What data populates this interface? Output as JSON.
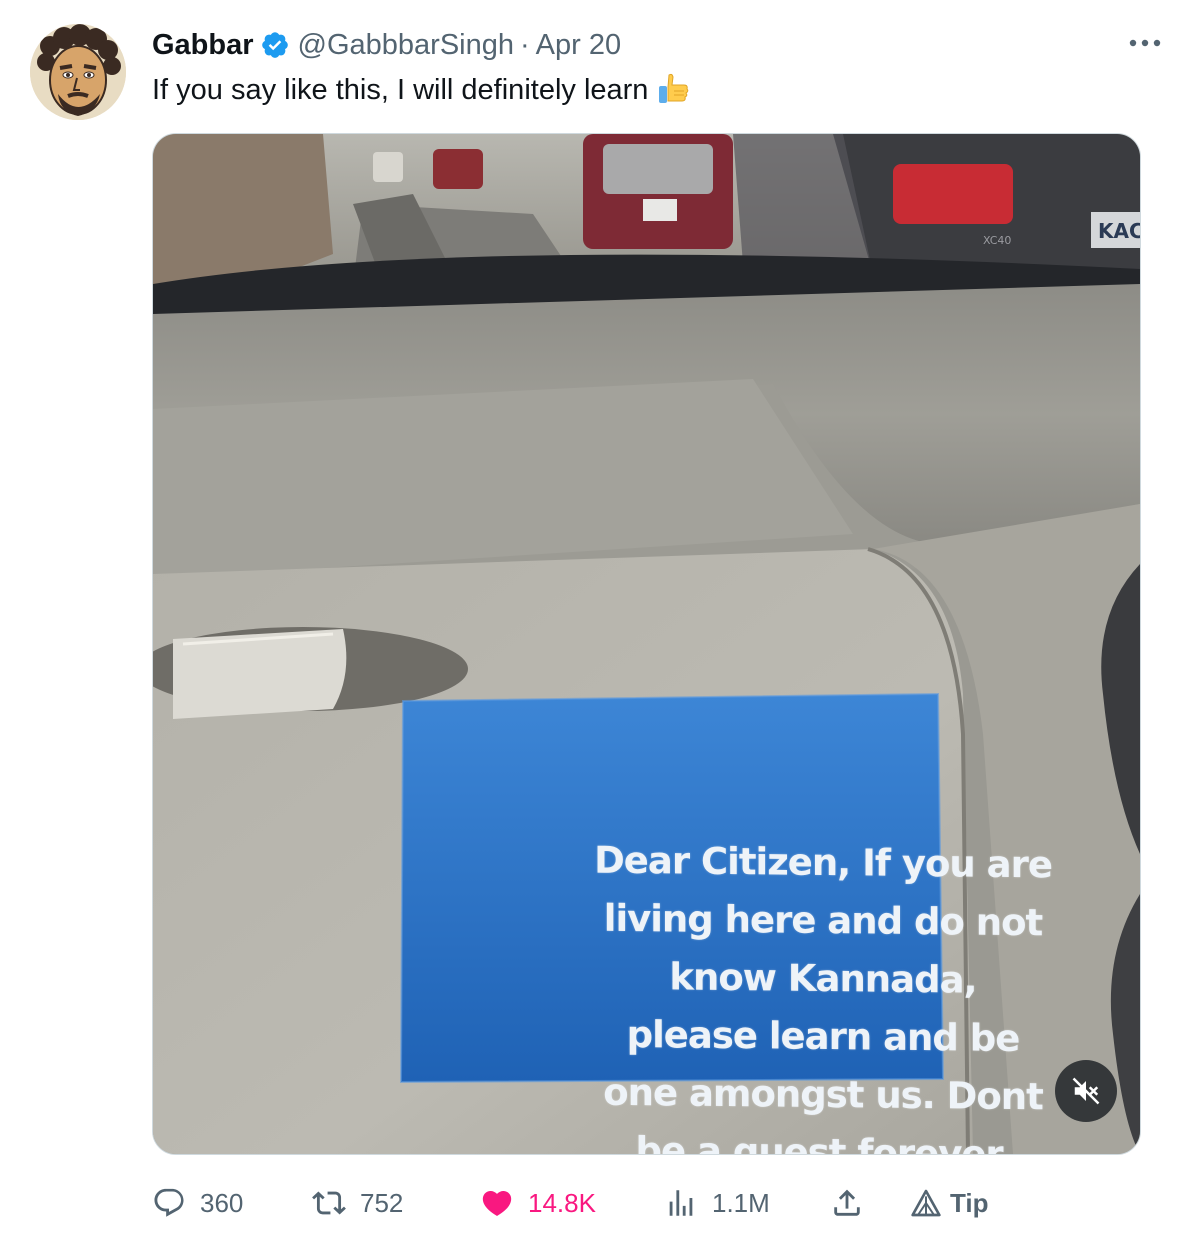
{
  "tweet": {
    "author_name": "Gabbar",
    "handle": "@GabbbarSingh",
    "separator": "·",
    "date": "Apr 20",
    "text": "If you say like this, I will definitely learn",
    "emoji_icon": "thumbs-up-icon",
    "verified_icon": "verified-badge-icon",
    "more_icon": "more-options-icon"
  },
  "media": {
    "sticker_lines": [
      "Dear Citizen, If you are",
      "living here and do not",
      "know Kannada,",
      "please learn and be",
      "one amongst us. Dont",
      "be a guest forever."
    ],
    "license_plate_text": "KAC",
    "car_badge_text": "XC40",
    "mute_icon": "speaker-muted-icon"
  },
  "actions": {
    "reply": {
      "icon": "reply-icon",
      "count": "360"
    },
    "retweet": {
      "icon": "retweet-icon",
      "count": "752"
    },
    "like": {
      "icon": "heart-icon",
      "count": "14.8K"
    },
    "views": {
      "icon": "views-chart-icon",
      "count": "1.1M"
    },
    "share": {
      "icon": "share-icon"
    },
    "tip": {
      "icon": "tip-icon",
      "label": "Tip"
    }
  },
  "colors": {
    "text": "#0f1419",
    "secondary": "#536471",
    "like_active": "#f91880",
    "verified": "#1d9bf0",
    "sticker_blue": "#2d74c4"
  }
}
